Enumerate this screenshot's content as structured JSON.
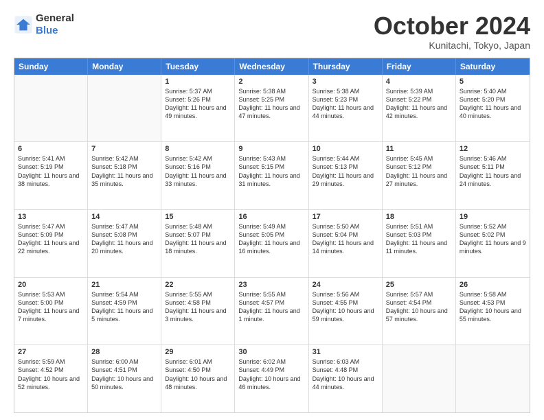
{
  "logo": {
    "general": "General",
    "blue": "Blue"
  },
  "title": "October 2024",
  "location": "Kunitachi, Tokyo, Japan",
  "header_days": [
    "Sunday",
    "Monday",
    "Tuesday",
    "Wednesday",
    "Thursday",
    "Friday",
    "Saturday"
  ],
  "rows": [
    [
      {
        "day": "",
        "text": "",
        "empty": true
      },
      {
        "day": "",
        "text": "",
        "empty": true
      },
      {
        "day": "1",
        "text": "Sunrise: 5:37 AM\nSunset: 5:26 PM\nDaylight: 11 hours and 49 minutes."
      },
      {
        "day": "2",
        "text": "Sunrise: 5:38 AM\nSunset: 5:25 PM\nDaylight: 11 hours and 47 minutes."
      },
      {
        "day": "3",
        "text": "Sunrise: 5:38 AM\nSunset: 5:23 PM\nDaylight: 11 hours and 44 minutes."
      },
      {
        "day": "4",
        "text": "Sunrise: 5:39 AM\nSunset: 5:22 PM\nDaylight: 11 hours and 42 minutes."
      },
      {
        "day": "5",
        "text": "Sunrise: 5:40 AM\nSunset: 5:20 PM\nDaylight: 11 hours and 40 minutes."
      }
    ],
    [
      {
        "day": "6",
        "text": "Sunrise: 5:41 AM\nSunset: 5:19 PM\nDaylight: 11 hours and 38 minutes."
      },
      {
        "day": "7",
        "text": "Sunrise: 5:42 AM\nSunset: 5:18 PM\nDaylight: 11 hours and 35 minutes."
      },
      {
        "day": "8",
        "text": "Sunrise: 5:42 AM\nSunset: 5:16 PM\nDaylight: 11 hours and 33 minutes."
      },
      {
        "day": "9",
        "text": "Sunrise: 5:43 AM\nSunset: 5:15 PM\nDaylight: 11 hours and 31 minutes."
      },
      {
        "day": "10",
        "text": "Sunrise: 5:44 AM\nSunset: 5:13 PM\nDaylight: 11 hours and 29 minutes."
      },
      {
        "day": "11",
        "text": "Sunrise: 5:45 AM\nSunset: 5:12 PM\nDaylight: 11 hours and 27 minutes."
      },
      {
        "day": "12",
        "text": "Sunrise: 5:46 AM\nSunset: 5:11 PM\nDaylight: 11 hours and 24 minutes."
      }
    ],
    [
      {
        "day": "13",
        "text": "Sunrise: 5:47 AM\nSunset: 5:09 PM\nDaylight: 11 hours and 22 minutes."
      },
      {
        "day": "14",
        "text": "Sunrise: 5:47 AM\nSunset: 5:08 PM\nDaylight: 11 hours and 20 minutes."
      },
      {
        "day": "15",
        "text": "Sunrise: 5:48 AM\nSunset: 5:07 PM\nDaylight: 11 hours and 18 minutes."
      },
      {
        "day": "16",
        "text": "Sunrise: 5:49 AM\nSunset: 5:05 PM\nDaylight: 11 hours and 16 minutes."
      },
      {
        "day": "17",
        "text": "Sunrise: 5:50 AM\nSunset: 5:04 PM\nDaylight: 11 hours and 14 minutes."
      },
      {
        "day": "18",
        "text": "Sunrise: 5:51 AM\nSunset: 5:03 PM\nDaylight: 11 hours and 11 minutes."
      },
      {
        "day": "19",
        "text": "Sunrise: 5:52 AM\nSunset: 5:02 PM\nDaylight: 11 hours and 9 minutes."
      }
    ],
    [
      {
        "day": "20",
        "text": "Sunrise: 5:53 AM\nSunset: 5:00 PM\nDaylight: 11 hours and 7 minutes."
      },
      {
        "day": "21",
        "text": "Sunrise: 5:54 AM\nSunset: 4:59 PM\nDaylight: 11 hours and 5 minutes."
      },
      {
        "day": "22",
        "text": "Sunrise: 5:55 AM\nSunset: 4:58 PM\nDaylight: 11 hours and 3 minutes."
      },
      {
        "day": "23",
        "text": "Sunrise: 5:55 AM\nSunset: 4:57 PM\nDaylight: 11 hours and 1 minute."
      },
      {
        "day": "24",
        "text": "Sunrise: 5:56 AM\nSunset: 4:55 PM\nDaylight: 10 hours and 59 minutes."
      },
      {
        "day": "25",
        "text": "Sunrise: 5:57 AM\nSunset: 4:54 PM\nDaylight: 10 hours and 57 minutes."
      },
      {
        "day": "26",
        "text": "Sunrise: 5:58 AM\nSunset: 4:53 PM\nDaylight: 10 hours and 55 minutes."
      }
    ],
    [
      {
        "day": "27",
        "text": "Sunrise: 5:59 AM\nSunset: 4:52 PM\nDaylight: 10 hours and 52 minutes."
      },
      {
        "day": "28",
        "text": "Sunrise: 6:00 AM\nSunset: 4:51 PM\nDaylight: 10 hours and 50 minutes."
      },
      {
        "day": "29",
        "text": "Sunrise: 6:01 AM\nSunset: 4:50 PM\nDaylight: 10 hours and 48 minutes."
      },
      {
        "day": "30",
        "text": "Sunrise: 6:02 AM\nSunset: 4:49 PM\nDaylight: 10 hours and 46 minutes."
      },
      {
        "day": "31",
        "text": "Sunrise: 6:03 AM\nSunset: 4:48 PM\nDaylight: 10 hours and 44 minutes."
      },
      {
        "day": "",
        "text": "",
        "empty": true
      },
      {
        "day": "",
        "text": "",
        "empty": true
      }
    ]
  ]
}
